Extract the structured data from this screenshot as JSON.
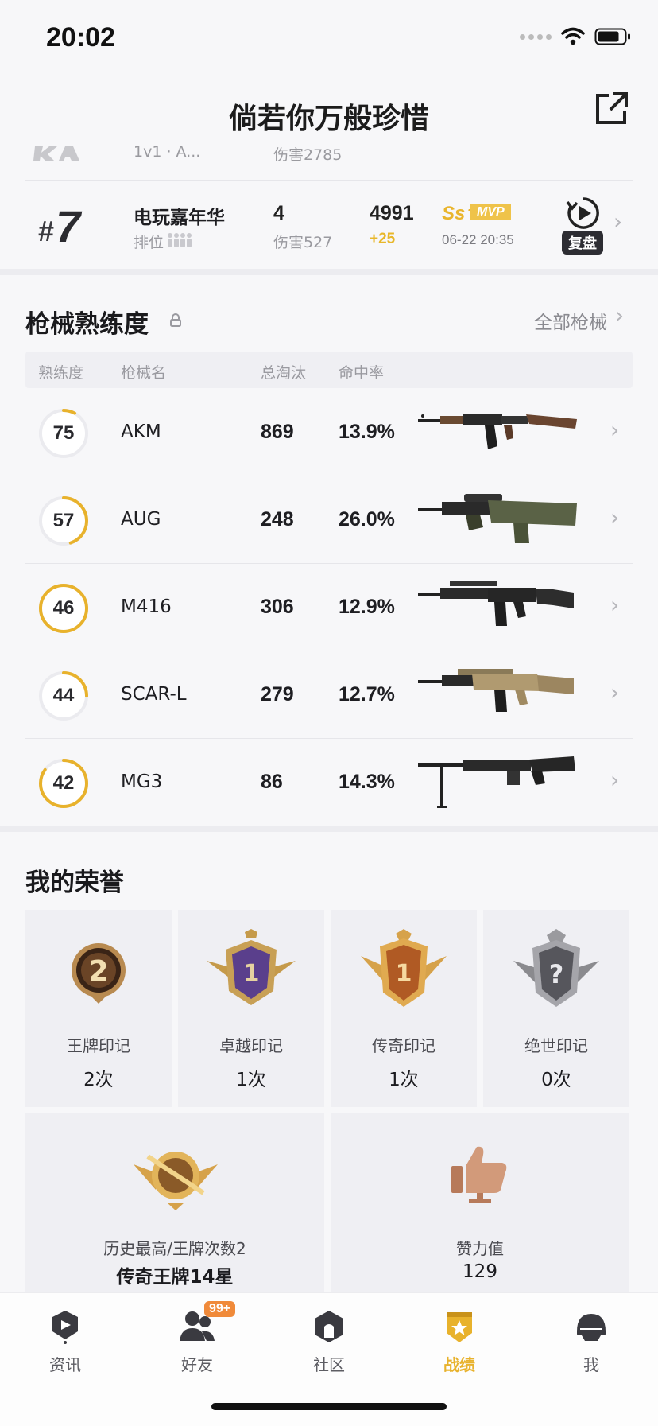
{
  "status_bar": {
    "time": "20:02"
  },
  "header": {
    "title": "倘若你万般珍惜"
  },
  "prev_match": {
    "mode": "1v1 · A...",
    "damage": "伤害2785"
  },
  "match": {
    "rank_hash": "#",
    "rank": "7",
    "mode": "电玩嘉年华",
    "mode_sub": "排位",
    "kills": "4",
    "damage": "伤害527",
    "score": "4991",
    "score_delta": "+25",
    "grade": "Ss⁺",
    "mvp": "MVP",
    "time": "06-22 20:35",
    "replay_label": "复盘"
  },
  "weapons": {
    "title": "枪械熟练度",
    "see_all": "全部枪械",
    "headers": [
      "熟练度",
      "枪械名",
      "总淘汰",
      "命中率"
    ],
    "rows": [
      {
        "proficiency": "75",
        "progress": 0.08,
        "name": "AKM",
        "kills": "869",
        "accuracy": "13.9%"
      },
      {
        "proficiency": "57",
        "progress": 0.45,
        "name": "AUG",
        "kills": "248",
        "accuracy": "26.0%"
      },
      {
        "proficiency": "46",
        "progress": 1.0,
        "name": "M416",
        "kills": "306",
        "accuracy": "12.9%"
      },
      {
        "proficiency": "44",
        "progress": 0.25,
        "name": "SCAR-L",
        "kills": "279",
        "accuracy": "12.7%"
      },
      {
        "proficiency": "42",
        "progress": 0.85,
        "name": "MG3",
        "kills": "86",
        "accuracy": "14.3%"
      }
    ]
  },
  "honors": {
    "title": "我的荣誉",
    "items": [
      {
        "label": "王牌印记",
        "count": "2次"
      },
      {
        "label": "卓越印记",
        "count": "1次"
      },
      {
        "label": "传奇印记",
        "count": "1次"
      },
      {
        "label": "绝世印记",
        "count": "0次"
      }
    ],
    "history_label": "历史最高/王牌次数2",
    "history_value": "传奇王牌14星",
    "likes_label": "赞力值",
    "likes_value": "129"
  },
  "tabs": [
    {
      "label": "资讯",
      "icon": "news-icon"
    },
    {
      "label": "好友",
      "icon": "friends-icon",
      "badge": "99+"
    },
    {
      "label": "社区",
      "icon": "community-icon"
    },
    {
      "label": "战绩",
      "icon": "record-icon",
      "active": true
    },
    {
      "label": "我",
      "icon": "helmet-icon"
    }
  ],
  "colors": {
    "accent": "#e8b22c",
    "ring_track": "#ebebef"
  }
}
